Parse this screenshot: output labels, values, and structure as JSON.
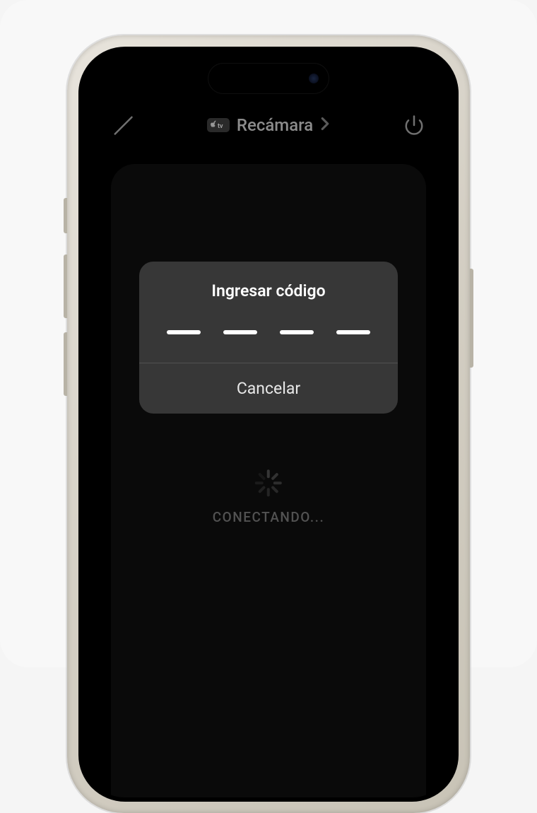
{
  "header": {
    "device_name": "Recámara",
    "appletv_label": "tv"
  },
  "modal": {
    "title": "Ingresar código",
    "cancel_label": "Cancelar",
    "code_length": 4
  },
  "status": {
    "connecting_label": "CONECTANDO..."
  },
  "icons": {
    "mute": "mute-icon",
    "power": "power-icon",
    "chevron": "chevron-right-icon"
  }
}
